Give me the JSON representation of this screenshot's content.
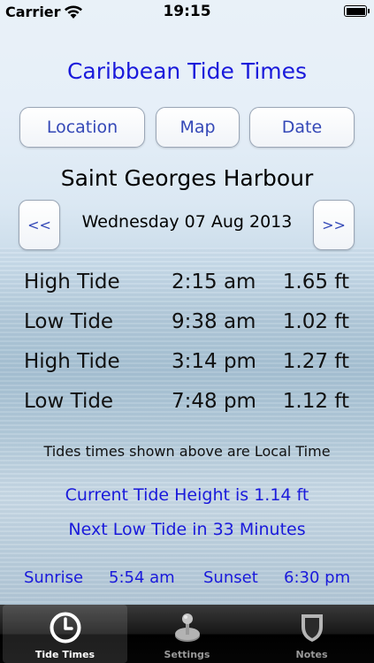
{
  "status_bar": {
    "carrier": "Carrier",
    "time": "19:15"
  },
  "app": {
    "title": "Caribbean Tide Times"
  },
  "buttons": {
    "location": "Location",
    "map": "Map",
    "date": "Date"
  },
  "location_name": "Saint Georges Harbour",
  "date_nav": {
    "prev": "<<",
    "date": "Wednesday 07 Aug 2013",
    "next": ">>"
  },
  "tides": [
    {
      "type": "High Tide",
      "time": "2:15 am",
      "height": "1.65 ft"
    },
    {
      "type": "Low Tide",
      "time": "9:38 am",
      "height": "1.02 ft"
    },
    {
      "type": "High Tide",
      "time": "3:14 pm",
      "height": "1.27 ft"
    },
    {
      "type": "Low Tide",
      "time": "7:48 pm",
      "height": "1.12 ft"
    }
  ],
  "note": "Tides times shown above are Local Time",
  "current_height": "Current Tide Height is 1.14 ft",
  "next_tide": "Next Low Tide in 33 Minutes",
  "sun": {
    "sunrise_label": "Sunrise",
    "sunrise": "5:54 am",
    "sunset_label": "Sunset",
    "sunset": "6:30 pm"
  },
  "tabs": [
    {
      "label": "Tide Times",
      "icon": "clock-icon",
      "active": true
    },
    {
      "label": "Settings",
      "icon": "joystick-icon",
      "active": false
    },
    {
      "label": "Notes",
      "icon": "shield-icon",
      "active": false
    }
  ],
  "colors": {
    "accent": "#1a1adb",
    "button_text": "#3448b7",
    "tabbar": "#000000"
  }
}
